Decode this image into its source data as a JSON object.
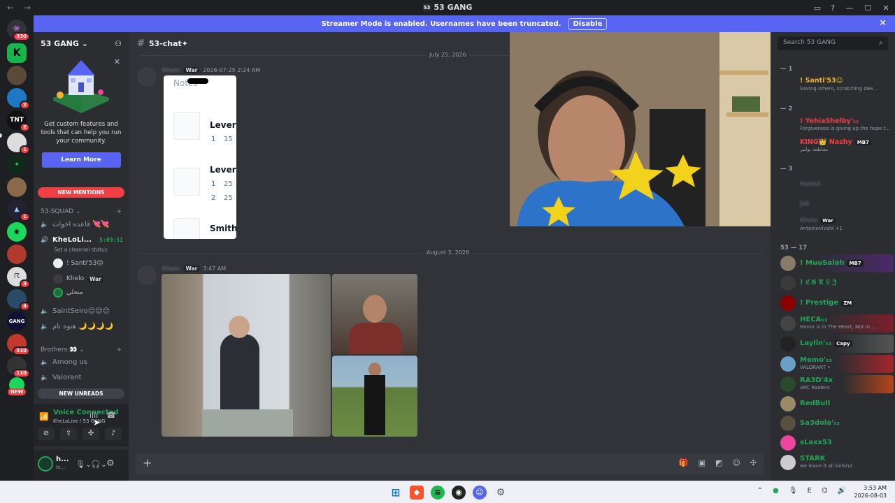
{
  "window": {
    "title": "53 GANG",
    "back_icon": "←",
    "forward_icon": "→"
  },
  "banner": {
    "text": "Streamer Mode is enabled. Usernames have been truncated.",
    "button": "Disable"
  },
  "rail": {
    "items": [
      {
        "name": "home",
        "badge": "330"
      },
      {
        "name": "k-server",
        "badge": ""
      },
      {
        "name": "server-2",
        "badge": ""
      },
      {
        "name": "server-3",
        "badge": "2"
      },
      {
        "name": "tnt",
        "label": "TNT",
        "badge": "2"
      },
      {
        "name": "server-5",
        "badge": "1"
      },
      {
        "name": "server-6",
        "badge": ""
      },
      {
        "name": "server-7",
        "badge": ""
      },
      {
        "name": "server-8",
        "badge": "1"
      },
      {
        "name": "server-9",
        "badge": ""
      },
      {
        "name": "server-10",
        "badge": ""
      },
      {
        "name": "server-11",
        "badge": "3"
      },
      {
        "name": "server-12",
        "badge": "4"
      },
      {
        "name": "gang",
        "label": "GANG",
        "badge": ""
      },
      {
        "name": "server-14",
        "badge": "510"
      },
      {
        "name": "server-15",
        "badge": "110"
      },
      {
        "name": "server-16",
        "badge": ""
      }
    ],
    "new_label": "NEW"
  },
  "sidebar": {
    "server_name": "53 GANG",
    "promo_text": "Get custom features and tools that can help you run your community.",
    "learn_more": "Learn More",
    "new_mentions": "NEW MENTIONS",
    "category1": "53-SQUAD",
    "channels1": [
      {
        "name": "قاعده اخوات 💘💘",
        "time": ""
      },
      {
        "name": "KheLoLi...",
        "time": "5:09:51"
      }
    ],
    "channel_status": "Set a channel status",
    "voice_members": [
      {
        "name": "! Santi'53😉",
        "tag": ""
      },
      {
        "name": "Khelo",
        "tag": "War"
      },
      {
        "name": "منحلي",
        "tag": ""
      }
    ],
    "channels1b": [
      "SaintSeiro😊😊😊",
      "هنوه نام 🌙🌙🌙🌙"
    ],
    "category2": "Brothers.👀",
    "channels2": [
      "Among us",
      "Valorant"
    ],
    "new_unreads": "NEW UNREADS",
    "voice": {
      "status": "Voice Connected",
      "location": "KheLoLive / 53 GANG"
    },
    "user": {
      "name": "h...",
      "status": "In..."
    }
  },
  "chat": {
    "channel": "53-chat✦",
    "date1": "July 25, 2026",
    "msg1": {
      "author": "Khelo",
      "tag": "War",
      "timestamp": "2026-07-25 2:24 AM"
    },
    "image1": {
      "header": "Notes",
      "items": [
        {
          "label": "Lever",
          "rows": [
            {
              "n": "1",
              "v": "15"
            }
          ]
        },
        {
          "label": "Lever",
          "rows": [
            {
              "n": "1",
              "v": "25"
            },
            {
              "n": "2",
              "v": "25"
            }
          ]
        },
        {
          "label": "Smith",
          "rows": []
        }
      ]
    },
    "date2": "August 3, 2026",
    "msg2": {
      "author": "Khelo",
      "tag": "War",
      "timestamp": "3:47 AM"
    }
  },
  "members": {
    "search_placeholder": "Search 53 GANG",
    "group1": "— 1",
    "group2": "— 2",
    "group3": "— 3",
    "group4": "53 — 17",
    "top": [
      {
        "name": "! Santi'53😉",
        "status": "Saving others, scratching dee...",
        "color": "#f0b232"
      },
      {
        "name": "! YehiaShelby'₅₃",
        "status": "Forgiveness is giving up the hope t...",
        "color": "#f23f43"
      },
      {
        "name": "KING👑 Nashy",
        "status": "مقاطعة بولنير",
        "color": "#f23f43",
        "tag": "MB7"
      },
      {
        "name": "Hobbit",
        "status": "",
        "color": "#80848e"
      },
      {
        "name": "Jab",
        "status": "",
        "color": "#80848e"
      },
      {
        "name": "Khelo",
        "status": "AntonioVivald +1",
        "color": "#80848e",
        "tag": "War"
      }
    ],
    "list": [
      {
        "name": "! MuuSalah",
        "status": "",
        "tag": "MB7",
        "color": "#23a55a"
      },
      {
        "name": "! ℭ𝔊 𝔄 𝔏 𝔍",
        "status": "",
        "tag": "",
        "color": "#23a55a"
      },
      {
        "name": "! Prestige",
        "status": "",
        "tag": "ZM",
        "color": "#23a55a"
      },
      {
        "name": "HECA₅₃",
        "status": "Honor is in The Heart, Not In ...",
        "tag": "",
        "color": "#23a55a"
      },
      {
        "name": "Laylin'₅₃",
        "status": "",
        "tag": "Capy",
        "color": "#23a55a"
      },
      {
        "name": "Memo'₅₃",
        "status": "VALORANT •",
        "tag": "",
        "color": "#23a55a"
      },
      {
        "name": "RA3D'4x",
        "status": "ARC Raiders",
        "tag": "",
        "color": "#23a55a"
      },
      {
        "name": "RedBull",
        "status": "",
        "tag": "",
        "color": "#23a55a"
      },
      {
        "name": "Sa3dola'₅₃",
        "status": "",
        "tag": "",
        "color": "#23a55a"
      },
      {
        "name": "sLaxx53",
        "status": "",
        "tag": "",
        "color": "#23a55a"
      },
      {
        "name": "STARK",
        "status": "we leave it all behind",
        "tag": "",
        "color": "#23a55a"
      }
    ]
  },
  "taskbar": {
    "time": "3:53 AM",
    "date": "2026-08-03",
    "lang": "E"
  }
}
